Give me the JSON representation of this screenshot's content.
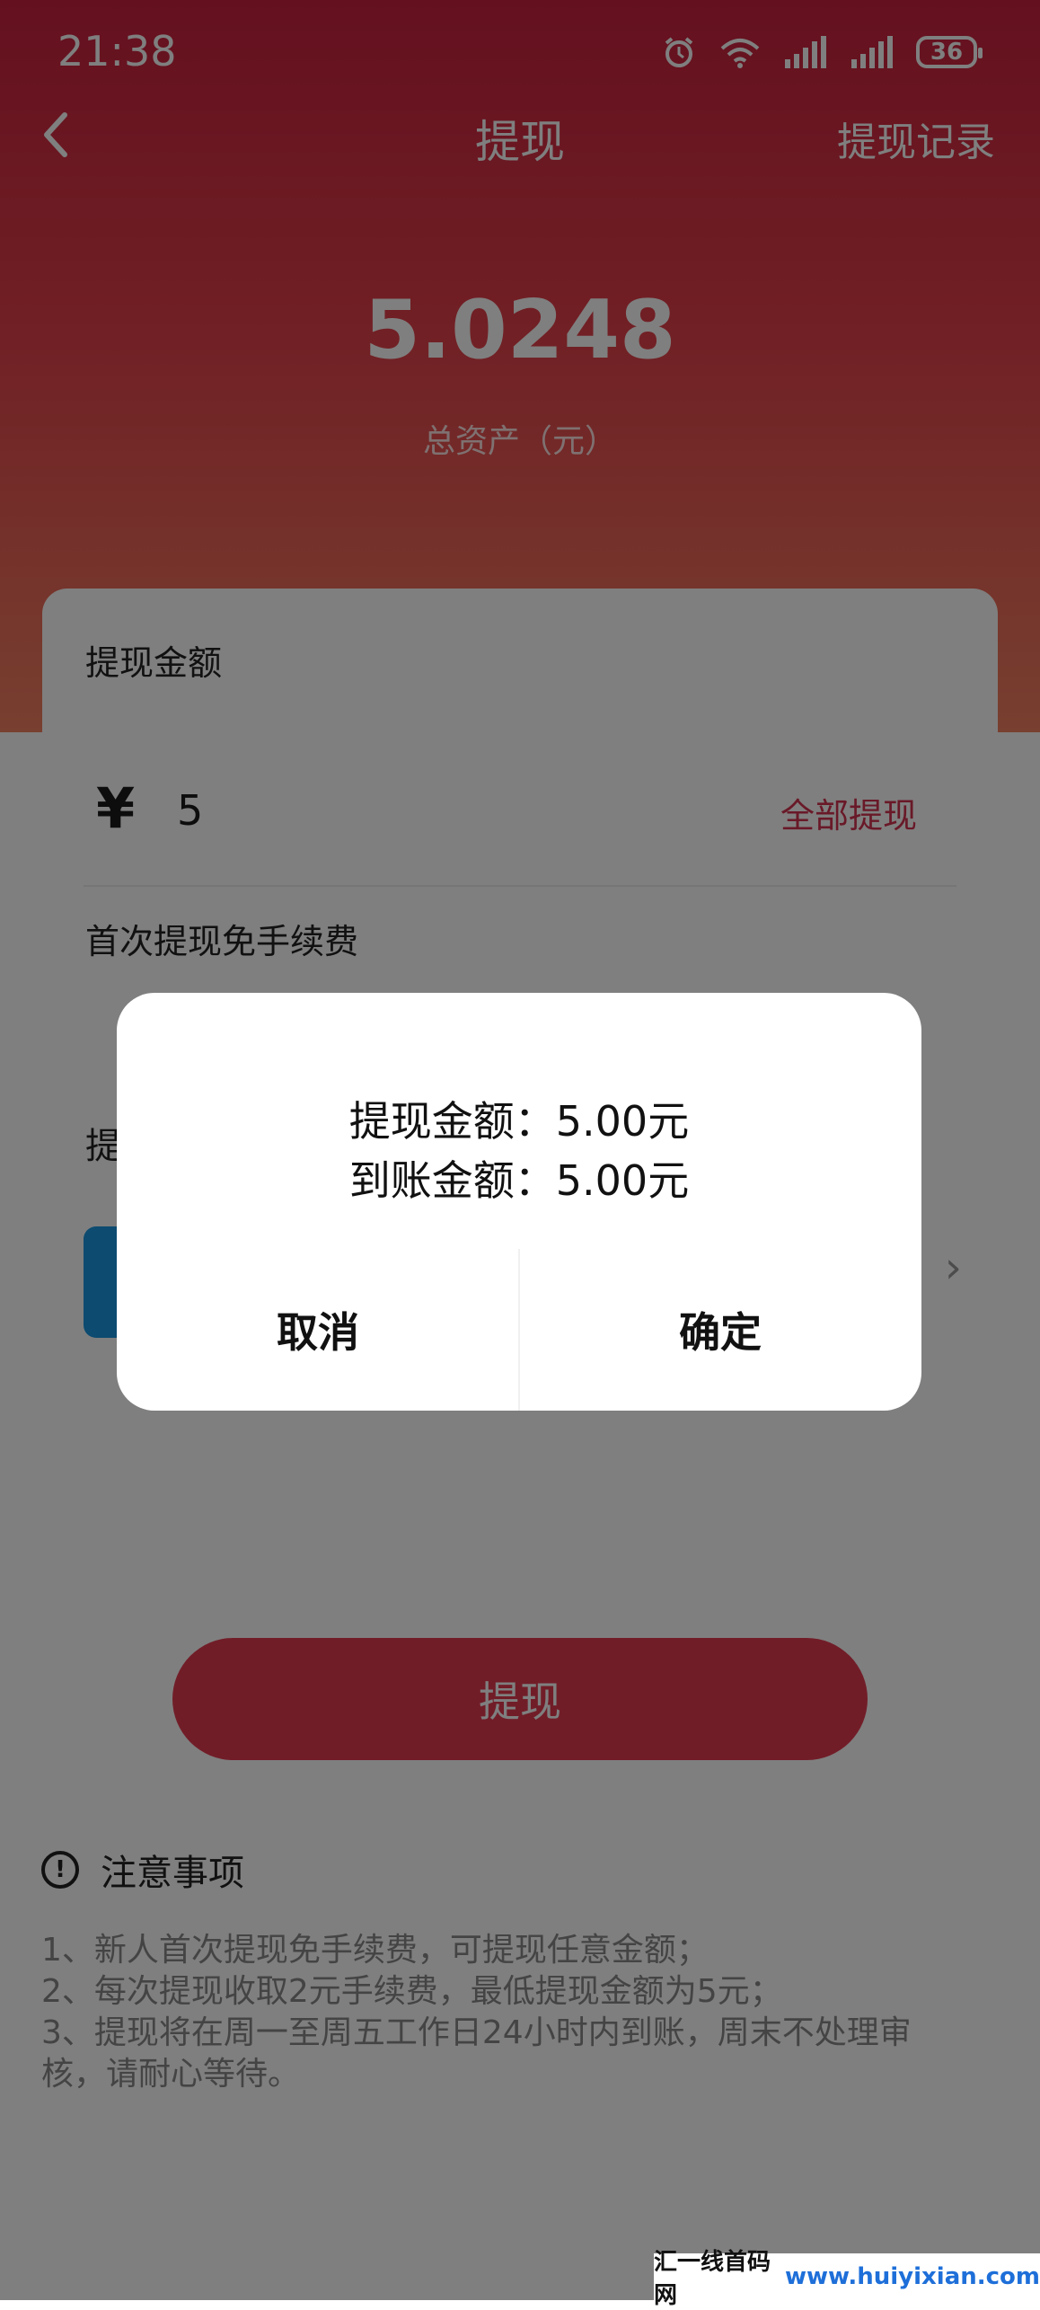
{
  "status": {
    "time": "21:38",
    "battery": "36"
  },
  "nav": {
    "title": "提现",
    "record_label": "提现记录"
  },
  "summary": {
    "total_amount": "5.0248",
    "total_label": "总资产（元）"
  },
  "amount_card": {
    "title": "提现金额",
    "currency_symbol": "¥",
    "amount_value": "5",
    "withdraw_all_label": "全部提现",
    "fee_note": "首次提现免手续费"
  },
  "method_card": {
    "title": "提"
  },
  "withdraw_button": "提现",
  "notice": {
    "icon_text": "!",
    "title": "注意事项",
    "items": [
      "1、新人首次提现免手续费，可提现任意金额；",
      "2、每次提现收取2元手续费，最低提现金额为5元；",
      "3、提现将在周一至周五工作日24小时内到账，周末不处理审核，请耐心等待。"
    ]
  },
  "dialog": {
    "line1": "提现金额：5.00元",
    "line2": "到账金额：5.00元",
    "cancel_label": "取消",
    "confirm_label": "确定"
  },
  "watermark": {
    "site_name": "汇一线首码网",
    "domain": "www.huiyixian.com"
  },
  "colors": {
    "brand_red": "#d23350",
    "method_blue": "#1a96e0"
  }
}
